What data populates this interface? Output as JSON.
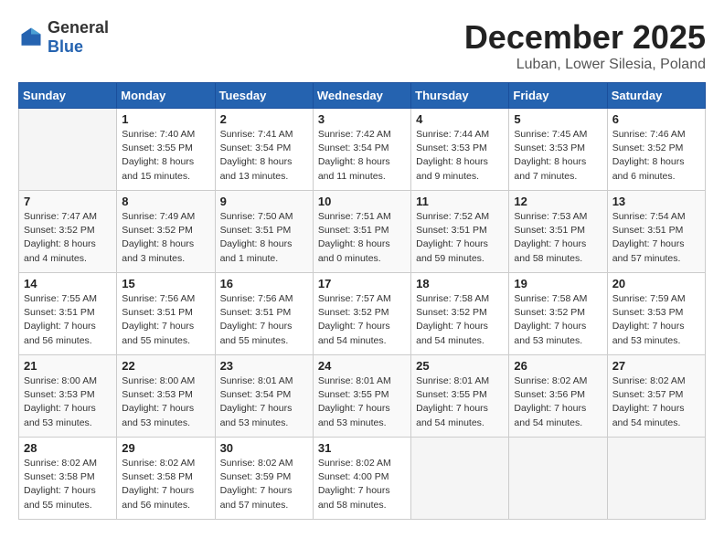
{
  "logo": {
    "general": "General",
    "blue": "Blue"
  },
  "title": {
    "month": "December 2025",
    "location": "Luban, Lower Silesia, Poland"
  },
  "headers": [
    "Sunday",
    "Monday",
    "Tuesday",
    "Wednesday",
    "Thursday",
    "Friday",
    "Saturday"
  ],
  "weeks": [
    [
      {
        "day": "",
        "info": ""
      },
      {
        "day": "1",
        "info": "Sunrise: 7:40 AM\nSunset: 3:55 PM\nDaylight: 8 hours\nand 15 minutes."
      },
      {
        "day": "2",
        "info": "Sunrise: 7:41 AM\nSunset: 3:54 PM\nDaylight: 8 hours\nand 13 minutes."
      },
      {
        "day": "3",
        "info": "Sunrise: 7:42 AM\nSunset: 3:54 PM\nDaylight: 8 hours\nand 11 minutes."
      },
      {
        "day": "4",
        "info": "Sunrise: 7:44 AM\nSunset: 3:53 PM\nDaylight: 8 hours\nand 9 minutes."
      },
      {
        "day": "5",
        "info": "Sunrise: 7:45 AM\nSunset: 3:53 PM\nDaylight: 8 hours\nand 7 minutes."
      },
      {
        "day": "6",
        "info": "Sunrise: 7:46 AM\nSunset: 3:52 PM\nDaylight: 8 hours\nand 6 minutes."
      }
    ],
    [
      {
        "day": "7",
        "info": "Sunrise: 7:47 AM\nSunset: 3:52 PM\nDaylight: 8 hours\nand 4 minutes."
      },
      {
        "day": "8",
        "info": "Sunrise: 7:49 AM\nSunset: 3:52 PM\nDaylight: 8 hours\nand 3 minutes."
      },
      {
        "day": "9",
        "info": "Sunrise: 7:50 AM\nSunset: 3:51 PM\nDaylight: 8 hours\nand 1 minute."
      },
      {
        "day": "10",
        "info": "Sunrise: 7:51 AM\nSunset: 3:51 PM\nDaylight: 8 hours\nand 0 minutes."
      },
      {
        "day": "11",
        "info": "Sunrise: 7:52 AM\nSunset: 3:51 PM\nDaylight: 7 hours\nand 59 minutes."
      },
      {
        "day": "12",
        "info": "Sunrise: 7:53 AM\nSunset: 3:51 PM\nDaylight: 7 hours\nand 58 minutes."
      },
      {
        "day": "13",
        "info": "Sunrise: 7:54 AM\nSunset: 3:51 PM\nDaylight: 7 hours\nand 57 minutes."
      }
    ],
    [
      {
        "day": "14",
        "info": "Sunrise: 7:55 AM\nSunset: 3:51 PM\nDaylight: 7 hours\nand 56 minutes."
      },
      {
        "day": "15",
        "info": "Sunrise: 7:56 AM\nSunset: 3:51 PM\nDaylight: 7 hours\nand 55 minutes."
      },
      {
        "day": "16",
        "info": "Sunrise: 7:56 AM\nSunset: 3:51 PM\nDaylight: 7 hours\nand 55 minutes."
      },
      {
        "day": "17",
        "info": "Sunrise: 7:57 AM\nSunset: 3:52 PM\nDaylight: 7 hours\nand 54 minutes."
      },
      {
        "day": "18",
        "info": "Sunrise: 7:58 AM\nSunset: 3:52 PM\nDaylight: 7 hours\nand 54 minutes."
      },
      {
        "day": "19",
        "info": "Sunrise: 7:58 AM\nSunset: 3:52 PM\nDaylight: 7 hours\nand 53 minutes."
      },
      {
        "day": "20",
        "info": "Sunrise: 7:59 AM\nSunset: 3:53 PM\nDaylight: 7 hours\nand 53 minutes."
      }
    ],
    [
      {
        "day": "21",
        "info": "Sunrise: 8:00 AM\nSunset: 3:53 PM\nDaylight: 7 hours\nand 53 minutes."
      },
      {
        "day": "22",
        "info": "Sunrise: 8:00 AM\nSunset: 3:53 PM\nDaylight: 7 hours\nand 53 minutes."
      },
      {
        "day": "23",
        "info": "Sunrise: 8:01 AM\nSunset: 3:54 PM\nDaylight: 7 hours\nand 53 minutes."
      },
      {
        "day": "24",
        "info": "Sunrise: 8:01 AM\nSunset: 3:55 PM\nDaylight: 7 hours\nand 53 minutes."
      },
      {
        "day": "25",
        "info": "Sunrise: 8:01 AM\nSunset: 3:55 PM\nDaylight: 7 hours\nand 54 minutes."
      },
      {
        "day": "26",
        "info": "Sunrise: 8:02 AM\nSunset: 3:56 PM\nDaylight: 7 hours\nand 54 minutes."
      },
      {
        "day": "27",
        "info": "Sunrise: 8:02 AM\nSunset: 3:57 PM\nDaylight: 7 hours\nand 54 minutes."
      }
    ],
    [
      {
        "day": "28",
        "info": "Sunrise: 8:02 AM\nSunset: 3:58 PM\nDaylight: 7 hours\nand 55 minutes."
      },
      {
        "day": "29",
        "info": "Sunrise: 8:02 AM\nSunset: 3:58 PM\nDaylight: 7 hours\nand 56 minutes."
      },
      {
        "day": "30",
        "info": "Sunrise: 8:02 AM\nSunset: 3:59 PM\nDaylight: 7 hours\nand 57 minutes."
      },
      {
        "day": "31",
        "info": "Sunrise: 8:02 AM\nSunset: 4:00 PM\nDaylight: 7 hours\nand 58 minutes."
      },
      {
        "day": "",
        "info": ""
      },
      {
        "day": "",
        "info": ""
      },
      {
        "day": "",
        "info": ""
      }
    ]
  ]
}
